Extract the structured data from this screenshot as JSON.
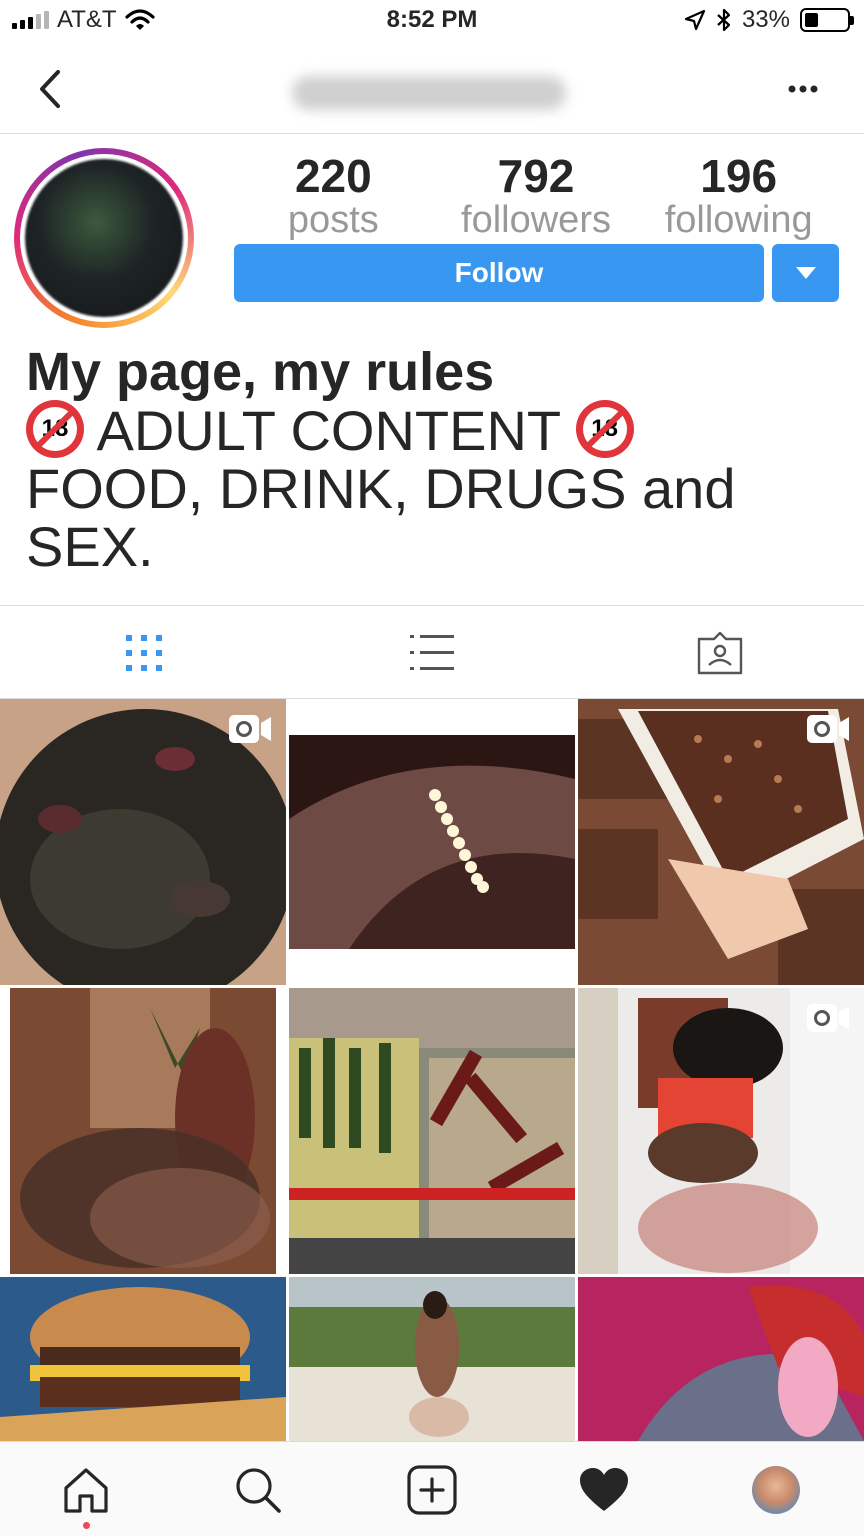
{
  "status_bar": {
    "carrier": "AT&T",
    "time": "8:52 PM",
    "battery": "33%",
    "battery_level": 0.33
  },
  "profile": {
    "stats": [
      {
        "value": "220",
        "label": "posts"
      },
      {
        "value": "792",
        "label": "followers"
      },
      {
        "value": "196",
        "label": "following"
      }
    ],
    "follow_label": "Follow",
    "bio_name": "My page, my rules",
    "bio_line1": "ADULT CONTENT",
    "bio_badge": "18",
    "bio_line2": "FOOD, DRINK, DRUGS and SEX."
  },
  "icons": {
    "back": "chevron-left-icon",
    "more": "more-horizontal-icon",
    "grid": "grid-icon",
    "list": "list-icon",
    "tagged": "tagged-photos-icon",
    "video": "video-icon",
    "home": "home-icon",
    "search": "search-icon",
    "add": "add-post-icon",
    "activity": "heart-icon",
    "profile": "profile-avatar"
  },
  "colors": {
    "accent": "#3897f0",
    "text": "#262626",
    "muted": "#999999",
    "notification": "#ed4956"
  },
  "posts": [
    {
      "kind": "meat",
      "is_video": true
    },
    {
      "kind": "belly",
      "is_video": false
    },
    {
      "kind": "chocolate-cake",
      "is_video": true
    },
    {
      "kind": "woman-blurred",
      "is_video": false
    },
    {
      "kind": "wine-carts",
      "is_video": false
    },
    {
      "kind": "dancer-blurred",
      "is_video": true
    },
    {
      "kind": "burger",
      "is_video": false
    },
    {
      "kind": "woman-park",
      "is_video": false
    },
    {
      "kind": "illustration",
      "is_video": false
    }
  ]
}
